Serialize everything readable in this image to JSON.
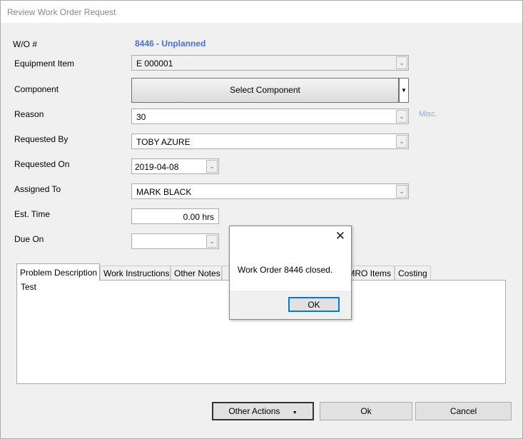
{
  "window": {
    "title": "Review Work Order Request"
  },
  "form": {
    "wo_label": "W/O #",
    "wo_value": "8446 - Unplanned",
    "equipment_label": "Equipment Item",
    "equipment_value": "E 000001",
    "component_label": "Component",
    "component_button": "Select Component",
    "reason_label": "Reason",
    "reason_value": "30",
    "misc_link": "Misc.",
    "requested_by_label": "Requested By",
    "requested_by_value": "TOBY AZURE",
    "requested_on_label": "Requested On",
    "requested_on_value": "2019-04-08",
    "assigned_to_label": "Assigned To",
    "assigned_to_value": "MARK BLACK",
    "est_time_label": "Est. Time",
    "est_time_value": "0.00 hrs",
    "due_on_label": "Due On",
    "due_on_value": ""
  },
  "tabs": [
    "Problem Description",
    "Work Instructions",
    "Other Notes",
    "MRO Items",
    "Costing"
  ],
  "problem_text": "Test",
  "buttons": {
    "other_actions": "Other Actions",
    "ok": "Ok",
    "cancel": "Cancel"
  },
  "dialog": {
    "message": "Work Order 8446 closed.",
    "ok": "OK"
  },
  "colors": {
    "accent": "#4a6fd0"
  }
}
